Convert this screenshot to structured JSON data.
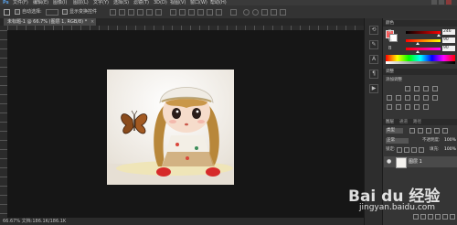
{
  "menubar": {
    "items": [
      "文件(F)",
      "编辑(E)",
      "图像(I)",
      "图层(L)",
      "文字(Y)",
      "选择(S)",
      "滤镜(T)",
      "3D(D)",
      "视图(V)",
      "窗口(W)",
      "帮助(H)"
    ]
  },
  "options": {
    "auto_select_label": "自动选择:",
    "transform_label": "显示变换控件"
  },
  "document": {
    "tab_label": "未标题-1 @ 66.7% (图层 1, RGB/8) *",
    "close_glyph": "×"
  },
  "status": {
    "text": "66.67%   文档:186.1K/186.1K"
  },
  "toolstrip": {
    "icons": [
      "history-icon",
      "brush-icon",
      "character-icon",
      "paragraph-icon",
      "actions-icon"
    ]
  },
  "color_panel": {
    "title": "颜色",
    "channels": [
      {
        "label": "R",
        "value": "246",
        "fraction": 0.96,
        "gradient": "linear-gradient(90deg,#000,#ff0000)"
      },
      {
        "label": "G",
        "value": "90",
        "fraction": 0.35,
        "gradient": "linear-gradient(90deg,#f00,#ff0)"
      },
      {
        "label": "B",
        "value": "90",
        "fraction": 0.35,
        "gradient": "linear-gradient(90deg,#f00,#f0f)"
      }
    ],
    "foreground_color": "#f65a5a"
  },
  "adjustments_panel": {
    "title": "调整",
    "subtitle": "添加调整"
  },
  "layers_panel": {
    "tabs": [
      "图层",
      "通道",
      "路径"
    ],
    "kind_filter": "类型",
    "blend_mode": "正常",
    "opacity_label": "不透明度:",
    "opacity_value": "100%",
    "lock_label": "锁定:",
    "fill_label": "填充:",
    "fill_value": "100%",
    "layers": [
      {
        "name": "图层 1"
      }
    ]
  },
  "watermark": {
    "brand": "Bai du 经验",
    "url": "jingyan.baidu.com"
  }
}
